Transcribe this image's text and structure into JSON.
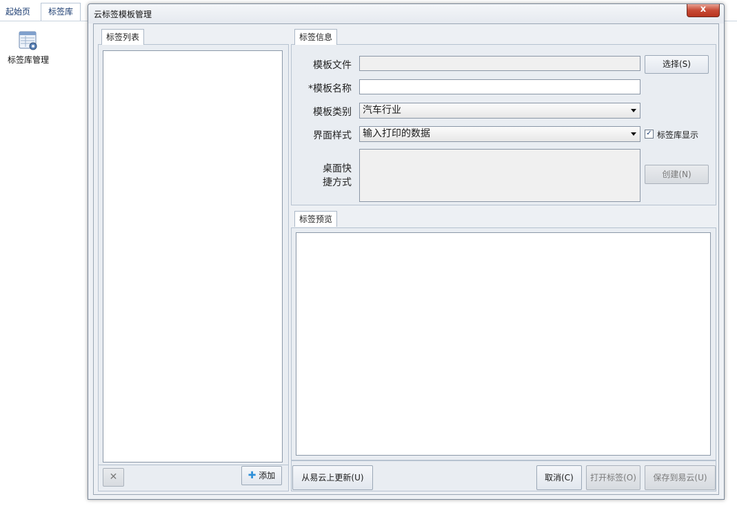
{
  "app": {
    "tabs": [
      {
        "label": "起始页"
      },
      {
        "label": "标签库"
      }
    ],
    "desktop_icon_label": "标签库管理"
  },
  "dialog": {
    "title": "云标签模板管理",
    "close_label": "x",
    "list_group": {
      "title": "标签列表",
      "delete_label": "✕",
      "add_label": "添加"
    },
    "info_group": {
      "title": "标签信息",
      "template_file_label": "模板文件",
      "template_file_value": "",
      "select_button": "选择(S)",
      "template_name_label": "*模板名称",
      "template_name_value": "",
      "category_label": "模板类别",
      "category_value": "汽车行业",
      "ui_style_label": "界面样式",
      "ui_style_value": "输入打印的数据",
      "library_display_label": "标签库显示",
      "library_display_checked": "✓",
      "shortcut_label_1": "桌面快",
      "shortcut_label_2": "捷方式",
      "create_button": "创建(N)"
    },
    "preview_group": {
      "title": "标签预览"
    },
    "footer": {
      "update_button": "从易云上更新(U)",
      "cancel_button": "取消(C)",
      "open_button": "打开标签(O)",
      "save_button": "保存到易云(U)"
    }
  }
}
